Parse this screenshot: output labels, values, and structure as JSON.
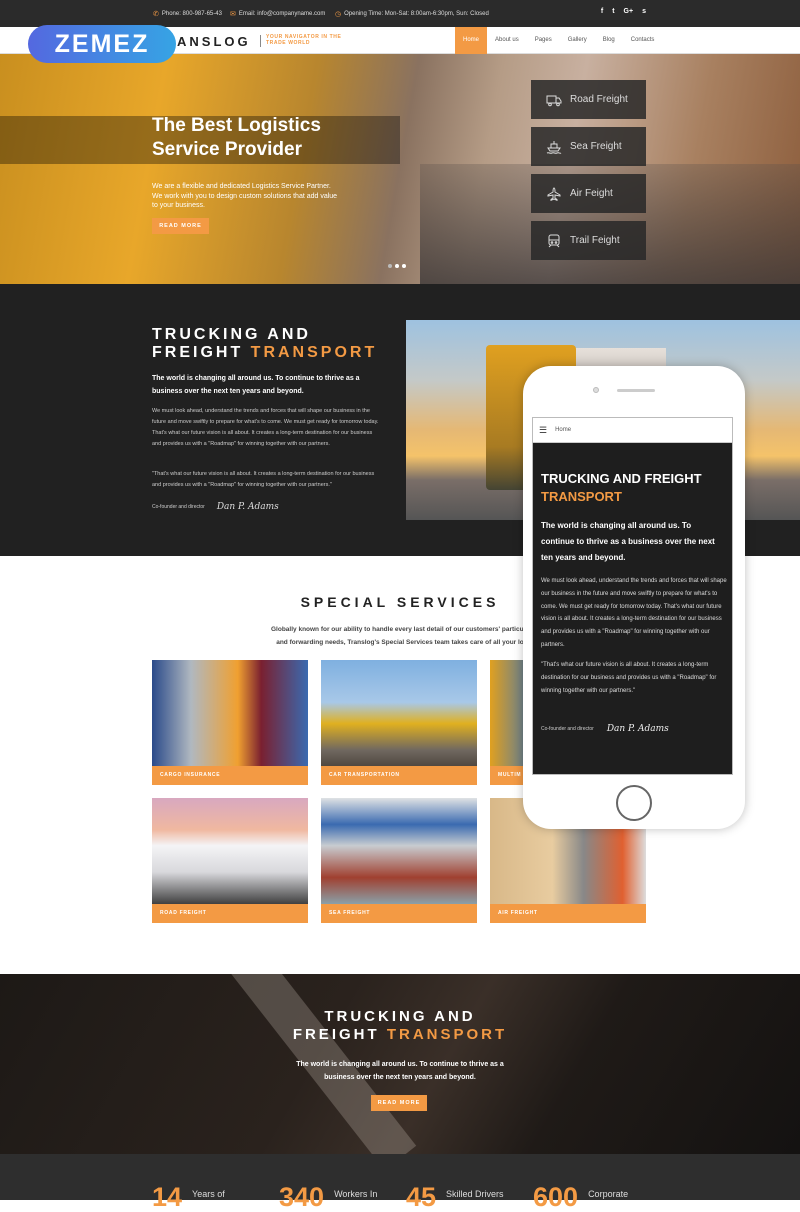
{
  "topbar": {
    "phone": "Phone: 800-987-65-43",
    "email": "Email: info@companyname.com",
    "hours": "Opening Time: Mon-Sat: 8:00am-6:30pm, Sun: Closed",
    "social": [
      "f",
      "t",
      "G+",
      "s"
    ]
  },
  "brand": {
    "name": "ANSLOG",
    "tagline_1": "YOUR NAVIGATOR IN THE",
    "tagline_2": "TRADE WORLD",
    "overlay_logo": "ZEMEZ"
  },
  "nav": {
    "items": [
      {
        "label": "Home",
        "active": true
      },
      {
        "label": "About us"
      },
      {
        "label": "Pages"
      },
      {
        "label": "Gallery"
      },
      {
        "label": "Blog"
      },
      {
        "label": "Contacts"
      }
    ]
  },
  "hero": {
    "title_1": "The Best Logistics",
    "title_2": "Service Provider",
    "text": "We are a flexible and dedicated Logistics Service Partner. We work with you to design custom solutions that add value to your business.",
    "button": "READ MORE",
    "slides_total": 3,
    "active_slide": 3,
    "freight_menu": [
      {
        "icon": "truck-icon",
        "label": "Road Freight"
      },
      {
        "icon": "ship-icon",
        "label": "Sea Freight"
      },
      {
        "icon": "plane-icon",
        "label": "Air Feight"
      },
      {
        "icon": "train-icon",
        "label": "Trail Feight"
      }
    ]
  },
  "about": {
    "title_1": "TRUCKING AND",
    "title_2": "FREIGHT",
    "title_accent": "TRANSPORT",
    "lead": "The world is changing all around us. To continue to thrive as a business over the next ten years and beyond.",
    "body": "We must look ahead, understand the trends and forces that will shape our business in the future and move swiftly to prepare for what's to come. We must get ready for tomorrow today. That's what our future vision is all about. It creates a long-term destination for our business and provides us with a \"Roadmap\" for winning together with our partners.",
    "quote": "\"That's what our future vision is all about. It creates a long-term destination for our business and provides us with a \"Roadmap\" for winning together with our partners.\"",
    "role": "Co-founder and director",
    "signature": "Dan P. Adams"
  },
  "phone": {
    "nav_label": "Home",
    "title": "TRUCKING AND FREIGHT",
    "title_accent": "TRANSPORT",
    "lead": "The world is changing all around us. To continue to thrive as a business over the next ten years and beyond.",
    "body": "We must look ahead, understand the trends and forces that will shape our business in the future and move swiftly to prepare for what's to come. We must get ready for tomorrow today. That's what our future vision is all about. It creates a long-term destination for our business and provides us with a \"Roadmap\" for winning together with our partners.",
    "quote": "\"That's what our future vision is all about. It creates a long-term destination for our business and provides us with a \"Roadmap\" for winning together with our partners.\"",
    "role": "Co-founder and director",
    "signature": "Dan P. Adams"
  },
  "services": {
    "title": "SPECIAL SERVICES",
    "desc_1": "Globally known for our ability to handle every last detail of our customers' particula",
    "desc_2": "and forwarding needs, Translog's Special Services team takes care of all your lo",
    "cards": [
      {
        "label": "CARGO INSURANCE"
      },
      {
        "label": "CAR TRANSPORTATION"
      },
      {
        "label": "MULTIM"
      },
      {
        "label": "ROAD FREIGHT"
      },
      {
        "label": "SEA FREIGHT"
      },
      {
        "label": "AIR FREIGHT"
      }
    ]
  },
  "cta": {
    "title_1": "TRUCKING AND",
    "title_2": "FREIGHT",
    "title_accent": "TRANSPORT",
    "text": "The world is changing all around us. To continue to thrive as a business over the next ten years and beyond.",
    "button": "READ MORE"
  },
  "stats": [
    {
      "number": "14",
      "label": "Years of"
    },
    {
      "number": "340",
      "label": "Workers In"
    },
    {
      "number": "45",
      "label": "Skilled Drivers"
    },
    {
      "number": "600",
      "label": "Corporate"
    }
  ],
  "colors": {
    "accent": "#f39a44",
    "dark": "#212121",
    "topbar": "#2b2b2b"
  }
}
